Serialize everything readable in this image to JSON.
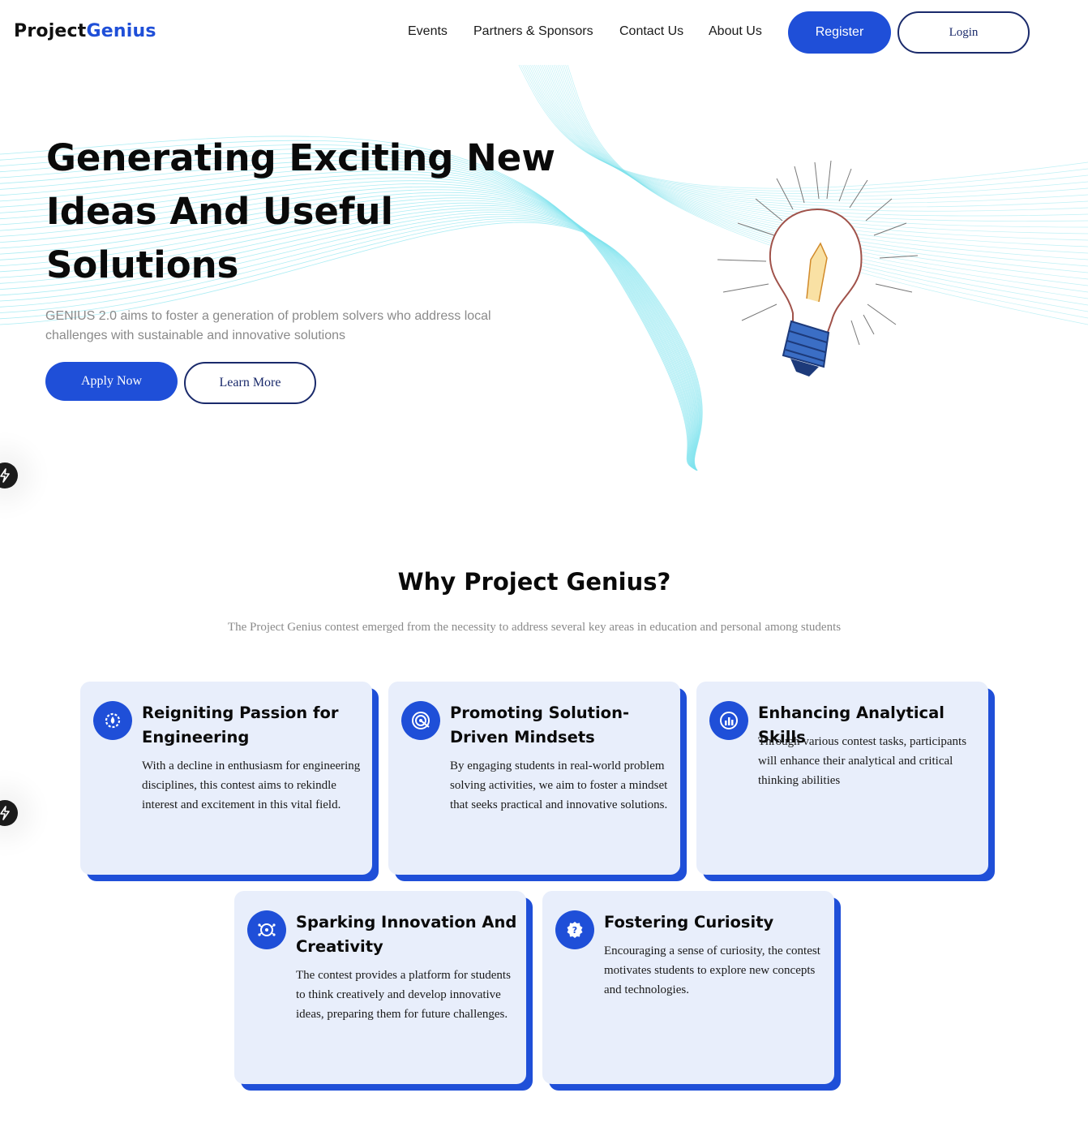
{
  "header": {
    "logo_part1": "Project",
    "logo_part2": "Genius",
    "nav": [
      "Events",
      "Partners & Sponsors",
      "Contact Us",
      "About Us"
    ],
    "register_label": "Register",
    "login_label": "Login"
  },
  "hero": {
    "title_line1": "Generating Exciting New",
    "title_line2": "Ideas And Useful",
    "title_line3": "Solutions",
    "subtitle": "GENIUS 2.0 aims to foster a generation of problem solvers who address local challenges with sustainable and innovative solutions",
    "apply_label": "Apply Now",
    "learn_label": "Learn More"
  },
  "why": {
    "title": "Why Project Genius?",
    "subtitle": "The Project Genius contest emerged from the necessity to address several key areas in education and personal among students",
    "cards": [
      {
        "icon": "gear-flame-icon",
        "title": "Reigniting Passion for Engineering",
        "text": "With a decline in enthusiasm for engineering disciplines, this contest aims to rekindle interest and excitement in this vital field."
      },
      {
        "icon": "target-icon",
        "title": "Promoting Solution-Driven Mindsets",
        "text": "By engaging students in real-world problem solving activities, we aim to foster a mindset that seeks practical and innovative solutions."
      },
      {
        "icon": "analytics-chart-icon",
        "title": "Enhancing Analytical Skills",
        "text": "Through various contest tasks, participants will enhance their analytical and critical thinking abilities"
      },
      {
        "icon": "brain-network-icon",
        "title": "Sparking Innovation And Creativity",
        "text": "The contest provides a platform for students to think creatively and develop innovative ideas, preparing them for future challenges."
      },
      {
        "icon": "question-badge-icon",
        "title": "Fostering Curiosity",
        "text": "Encouraging a sense of curiosity, the contest motivates students to explore new concepts and technologies."
      }
    ]
  },
  "colors": {
    "accent": "#1f4fd8",
    "card_bg": "#e8eefb",
    "outline": "#1a2a6b",
    "wave": "#7fe3ee"
  }
}
